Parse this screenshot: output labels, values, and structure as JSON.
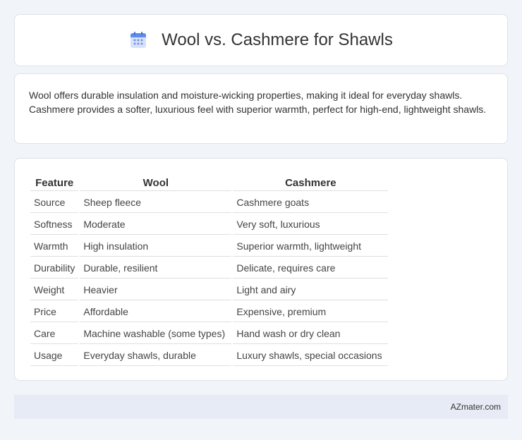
{
  "header": {
    "title": "Wool vs. Cashmere for Shawls",
    "icon": "calendar-icon",
    "icon_colors": {
      "top": "#5b8def",
      "body": "#c9d8fb",
      "dots": "#7a8fd8"
    }
  },
  "summary": {
    "text": "Wool offers durable insulation and moisture-wicking properties, making it ideal for everyday shawls. Cashmere provides a softer, luxurious feel with superior warmth, perfect for high-end, lightweight shawls."
  },
  "table": {
    "headers": [
      "Feature",
      "Wool",
      "Cashmere"
    ],
    "rows": [
      [
        "Source",
        "Sheep fleece",
        "Cashmere goats"
      ],
      [
        "Softness",
        "Moderate",
        "Very soft, luxurious"
      ],
      [
        "Warmth",
        "High insulation",
        "Superior warmth, lightweight"
      ],
      [
        "Durability",
        "Durable, resilient",
        "Delicate, requires care"
      ],
      [
        "Weight",
        "Heavier",
        "Light and airy"
      ],
      [
        "Price",
        "Affordable",
        "Expensive, premium"
      ],
      [
        "Care",
        "Machine washable (some types)",
        "Hand wash or dry clean"
      ],
      [
        "Usage",
        "Everyday shawls, durable",
        "Luxury shawls, special occasions"
      ]
    ]
  },
  "footer": {
    "brand": "AZmater.com"
  }
}
